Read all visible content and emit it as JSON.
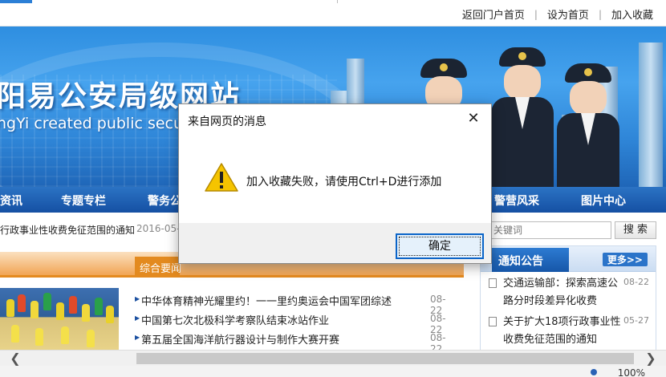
{
  "top_links": [
    "返回门户首页",
    "设为首页",
    "加入收藏"
  ],
  "banner": {
    "title": "阳易公安局级网站",
    "subtitle": "ngYi created public secur"
  },
  "nav": [
    "资讯",
    "专题专栏",
    "警务公",
    "警营风采",
    "图片中心"
  ],
  "notice": {
    "text": "行政事业性收费免征范围的通知",
    "date": "2016-05-2"
  },
  "search": {
    "placeholder": "关键词",
    "button": "搜 索"
  },
  "news_tab": "综合要闻",
  "news": [
    {
      "title": "中华体育精神光耀里约！一一里约奥运会中国军团综述",
      "date": "08-22"
    },
    {
      "title": "中国第七次北极科学考察队结束冰站作业",
      "date": "08-22"
    },
    {
      "title": "第五届全国海洋航行器设计与制作大赛开赛",
      "date": "08-22"
    }
  ],
  "sidebar": {
    "title": "通知公告",
    "more": "更多>>",
    "items": [
      {
        "text": "交通运输部：探索高速公路分时段差异化收费",
        "date": "08-22"
      },
      {
        "text": "关于扩大18项行政事业性收费免征范围的通知",
        "date": "05-27"
      }
    ]
  },
  "status": {
    "zoom": "100%"
  },
  "dialog": {
    "title": "来自网页的消息",
    "message": "加入收藏失败，请使用Ctrl+D进行添加",
    "ok": "确定",
    "close": "✕",
    "icon": "warning-icon"
  },
  "colors": {
    "nav_blue": "#1550a3",
    "tab_orange": "#e38a1f",
    "dialog_ok_border": "#0a64c8",
    "warning_yellow": "#f5c400"
  }
}
